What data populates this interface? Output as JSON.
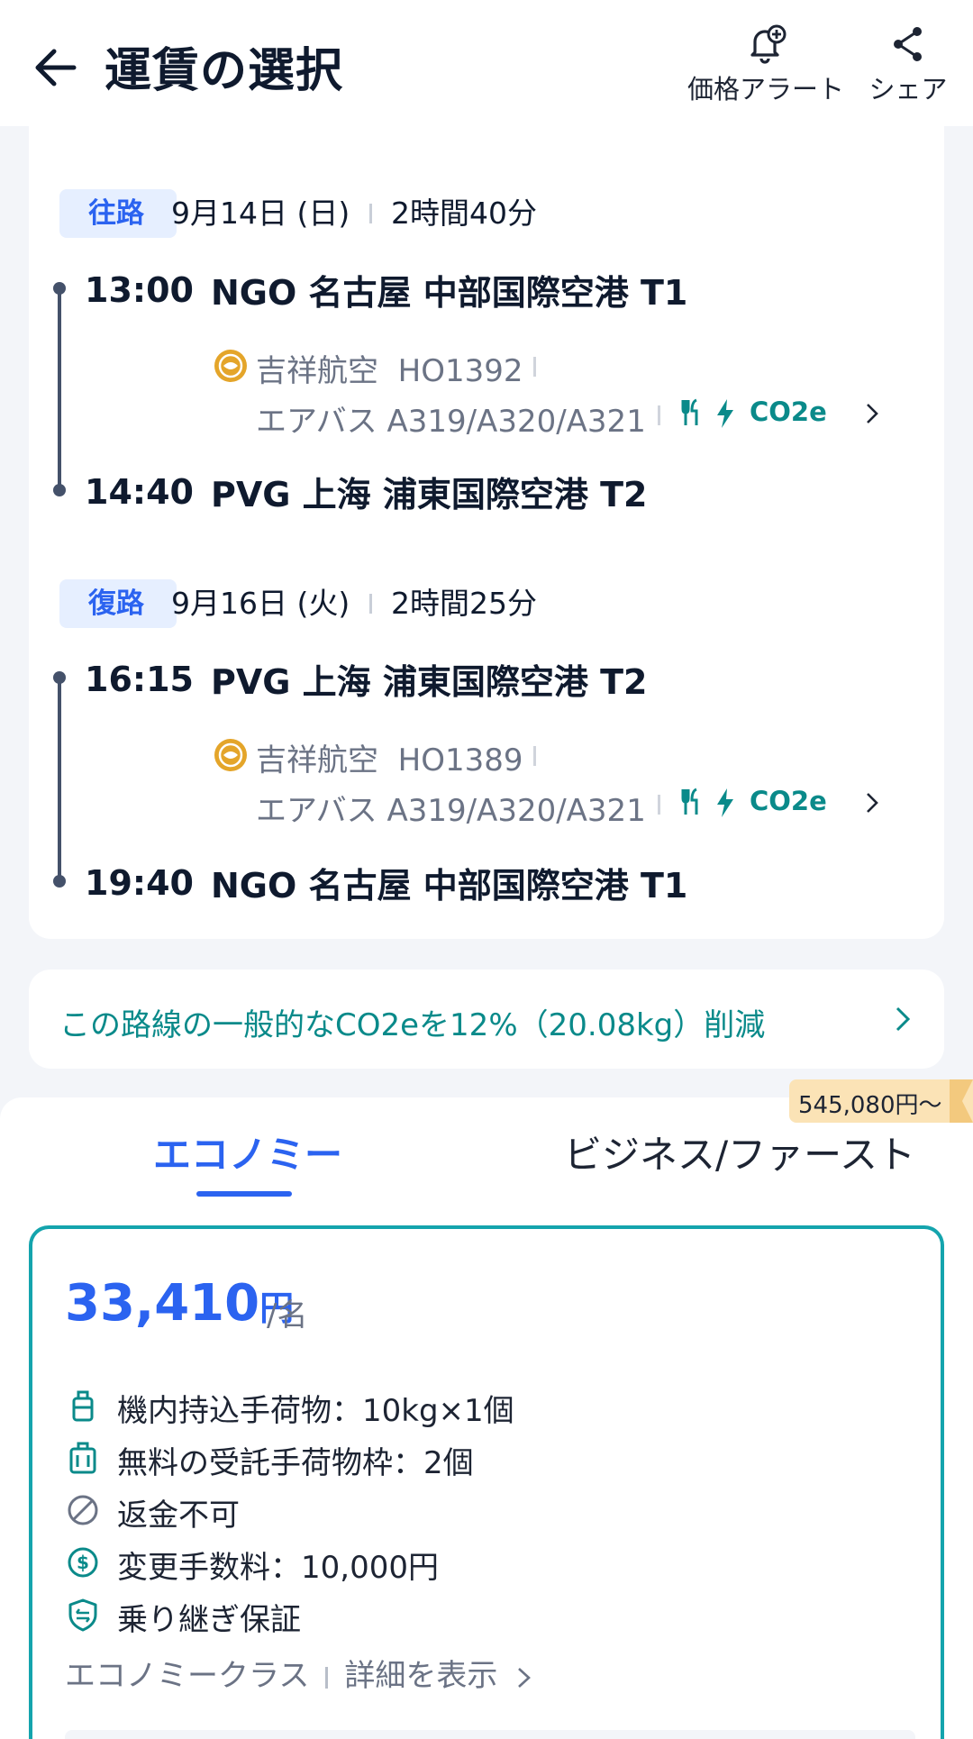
{
  "header": {
    "title": "運賃の選択",
    "price_alert_label": "価格アラート",
    "share_label": "シェア"
  },
  "outbound": {
    "tag": "往路",
    "date": "9月14日 (日)",
    "duration": "2時間40分",
    "dep_time": "13:00",
    "dep_airport": "NGO 名古屋 中部国際空港 T1",
    "airline": "吉祥航空",
    "flight_no": "HO1392",
    "aircraft": "エアバス A319/A320/A321",
    "co2": "CO2e",
    "arr_time": "14:40",
    "arr_airport": "PVG 上海 浦東国際空港 T2"
  },
  "inbound": {
    "tag": "復路",
    "date": "9月16日 (火)",
    "duration": "2時間25分",
    "dep_time": "16:15",
    "dep_airport": "PVG 上海 浦東国際空港 T2",
    "airline": "吉祥航空",
    "flight_no": "HO1389",
    "aircraft": "エアバス A319/A320/A321",
    "co2": "CO2e",
    "arr_time": "19:40",
    "arr_airport": "NGO 名古屋 中部国際空港 T1"
  },
  "co2_banner": "この路線の一般的なCO2eを12%（20.08kg）削減",
  "tabs": {
    "economy": "エコノミー",
    "business": "ビジネス/ファースト",
    "business_price": "545,080円～"
  },
  "fare": {
    "price": "33,410",
    "currency": "円",
    "per": "/名",
    "features": [
      {
        "icon": "carry-on-bag-icon",
        "text": "機内持込手荷物：10kg×1個"
      },
      {
        "icon": "checked-bag-icon",
        "text": "無料の受託手荷物枠：2個"
      },
      {
        "icon": "no-refund-icon",
        "text": "返金不可"
      },
      {
        "icon": "change-fee-icon",
        "text": "変更手数料：10,000円"
      },
      {
        "icon": "connection-guarantee-icon",
        "text": "乗り継ぎ保証"
      }
    ],
    "class_name": "エコノミークラス",
    "details_link": "詳細を表示"
  },
  "colors": {
    "accent": "#2b63f0",
    "teal": "#0a8a8a",
    "card_border": "#14a4ad",
    "airline_gold": "#e4a52a"
  }
}
